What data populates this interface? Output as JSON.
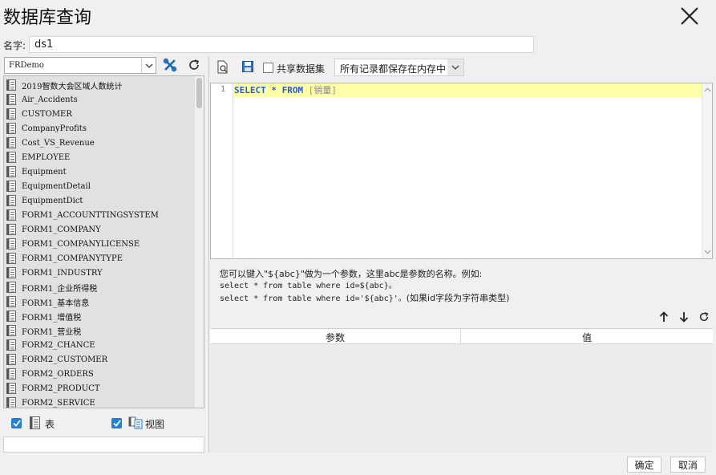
{
  "dialog": {
    "title": "数据库查询",
    "name_label": "名字:",
    "name_value": "ds1"
  },
  "left": {
    "connection": "FRDemo",
    "tables": [
      "2019智数大会区域人数统计",
      "Air_Accidents",
      "CUSTOMER",
      "CompanyProfits",
      "Cost_VS_Revenue",
      "EMPLOYEE",
      "Equipment",
      "EquipmentDetail",
      "EquipmentDict",
      "FORM1_ACCOUNTTINGSYSTEM",
      "FORM1_COMPANY",
      "FORM1_COMPANYLICENSE",
      "FORM1_COMPANYTYPE",
      "FORM1_INDUSTRY",
      "FORM1_企业所得税",
      "FORM1_基本信息",
      "FORM1_增值税",
      "FORM1_营业税",
      "FORM2_CHANCE",
      "FORM2_CUSTOMER",
      "FORM2_ORDERS",
      "FORM2_PRODUCT",
      "FORM2_SERVICE"
    ],
    "filter_table_label": "表",
    "filter_view_label": "视图"
  },
  "toolbar": {
    "shared_dataset_label": "共享数据集",
    "storage_mode": "所有记录都保存在内存中"
  },
  "editor": {
    "line_number": "1",
    "sql_kw1": "SELECT",
    "sql_star": "*",
    "sql_kw2": "FROM",
    "sql_table": "[销量]"
  },
  "hint": {
    "line1": "您可以键入\"${abc}\"做为一个参数，这里abc是参数的名称。例如:",
    "line2": "select * from table where id=${abc}。",
    "line3a": "select * from table where id='${abc}'。",
    "line3b": "(如果id字段为字符串类型)"
  },
  "params": {
    "col_param": "参数",
    "col_value": "值"
  },
  "footer": {
    "ok": "确定",
    "cancel": "取消"
  },
  "colors": {
    "accent": "#1e83d6",
    "highlight_line": "#ffffaa",
    "keyword": "#2a5bd7"
  }
}
